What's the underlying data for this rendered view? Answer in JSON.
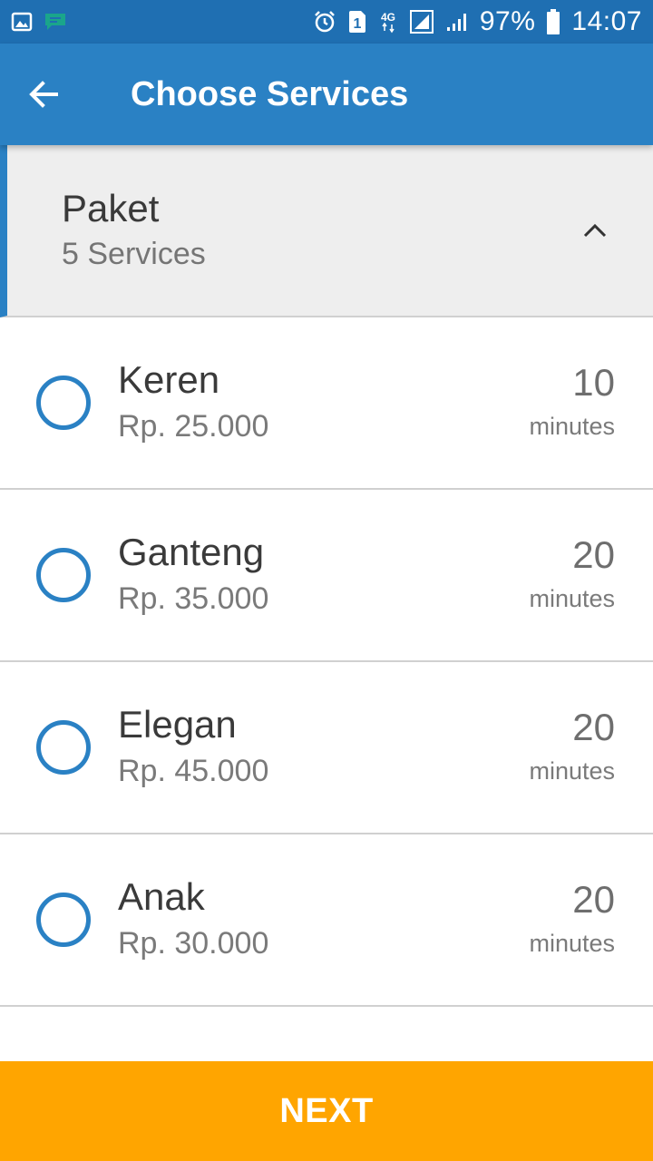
{
  "status_bar": {
    "battery": "97%",
    "time": "14:07",
    "network": "4G",
    "sim_slot": "1",
    "icons": [
      "image-icon",
      "message-icon",
      "alarm-icon",
      "sim-icon",
      "network-4g-icon",
      "signal-icon",
      "battery-icon"
    ]
  },
  "app_bar": {
    "title": "Choose Services",
    "back_icon": "arrow-left-icon"
  },
  "category": {
    "name": "Paket",
    "count": "5 Services",
    "toggle_icon": "chevron-up-icon"
  },
  "services": [
    {
      "name": "Keren",
      "price": "Rp. 25.000",
      "duration": "10",
      "unit": "minutes"
    },
    {
      "name": "Ganteng",
      "price": "Rp. 35.000",
      "duration": "20",
      "unit": "minutes"
    },
    {
      "name": "Elegan",
      "price": "Rp. 45.000",
      "duration": "20",
      "unit": "minutes"
    },
    {
      "name": "Anak",
      "price": "Rp. 30.000",
      "duration": "20",
      "unit": "minutes"
    }
  ],
  "actions": {
    "next_label": "NEXT"
  },
  "colors": {
    "status_bar": "#1f6fb2",
    "app_bar": "#2a81c4",
    "accent": "#2a81c4",
    "next_button": "#ffa500"
  }
}
